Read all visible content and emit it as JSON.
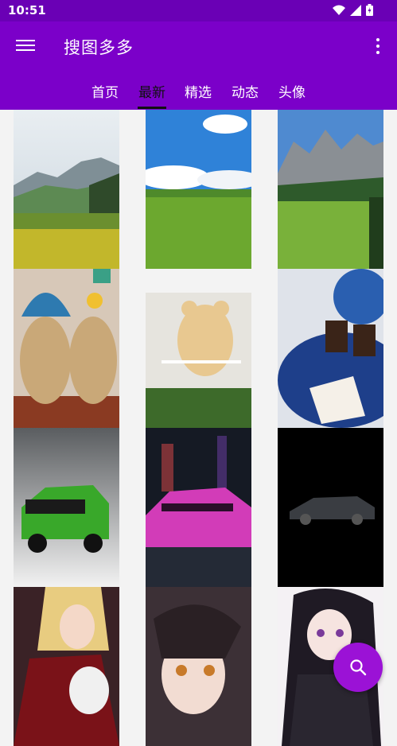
{
  "status_bar": {
    "time": "10:51"
  },
  "app_bar": {
    "title": "搜图多多"
  },
  "tabs": [
    {
      "label": "首页",
      "active": false
    },
    {
      "label": "最新",
      "active": true
    },
    {
      "label": "精选",
      "active": false
    },
    {
      "label": "动态",
      "active": false
    },
    {
      "label": "头像",
      "active": false
    }
  ],
  "images": [
    {
      "subject": "alpine meadow with yellow flowers"
    },
    {
      "subject": "green field under blue sky"
    },
    {
      "subject": "mountain village valley"
    },
    {
      "subject": "knitted plush dolls"
    },
    {
      "subject": "teddy bear on balcony"
    },
    {
      "subject": "coffee and cake with plush bear"
    },
    {
      "subject": "green SUV in snow"
    },
    {
      "subject": "pink sports car at night"
    },
    {
      "subject": "black sports car in dark"
    },
    {
      "subject": "anime blonde girl"
    },
    {
      "subject": "anime dark-haired girl"
    },
    {
      "subject": "anime black-haired girl"
    }
  ],
  "fab": {
    "icon": "search-icon"
  },
  "colors": {
    "primary": "#7b00c9",
    "status_bar": "#6a00b5",
    "fab": "#9b12d6"
  }
}
